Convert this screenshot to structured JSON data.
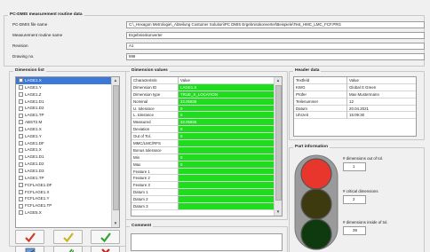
{
  "routine": {
    "title": "PC-DMIS measurement routine data",
    "fields": [
      {
        "label": "PC-DMIS file name",
        "value": "C:\\_Hexagon Metrologie\\_Abteilung Costumer Solution\\PC DMIS Ergebnisskonverter\\Beispiele\\Test_HMC_LMC_FCF.PRG"
      },
      {
        "label": "Measurement routine name",
        "value": "Ergebnisskonverter"
      },
      {
        "label": "Revision",
        "value": "A1"
      },
      {
        "label": "Drawing no.",
        "value": "999"
      }
    ]
  },
  "dimension_list": {
    "title": "Dimension list",
    "items": [
      "LAGE1.X",
      "LAGE1.Y",
      "LAGE1.Z",
      "LAGE1.D1",
      "LAGE1.D2",
      "LAGE1.TP",
      "ABST2.M",
      "LAGE1.X",
      "LAGE1.Y",
      "LAGE1.DF",
      "LAGE1.X",
      "LAGE1.D1",
      "LAGE1.D2",
      "LAGE1.D3",
      "LAGE1.TP",
      "FCFLAGE1.DF",
      "FCFLAGE1.X",
      "FCFLAGE1.Y",
      "FCFLAGE1.TP",
      "LAGE5.X"
    ],
    "selected_index": 0
  },
  "dimension_values": {
    "title": "Dimension values",
    "columns": [
      "Characteristic",
      "Value"
    ],
    "rows": [
      {
        "name": "Dimension ID",
        "value": "LAGE1.X"
      },
      {
        "name": "Dimension type",
        "value": "TRUE_X_LOCATION"
      },
      {
        "name": "Nominal",
        "value": "32.05838"
      },
      {
        "name": "U. tolerance",
        "value": "0"
      },
      {
        "name": "L. tolerance",
        "value": "0"
      },
      {
        "name": "Measured",
        "value": "32.05838"
      },
      {
        "name": "Deviation",
        "value": "0"
      },
      {
        "name": "Out of Tol.",
        "value": "0"
      },
      {
        "name": "MMC/LMC/RFS",
        "value": ""
      },
      {
        "name": "Bonus tolerance",
        "value": ""
      },
      {
        "name": "Min",
        "value": "0"
      },
      {
        "name": "Max",
        "value": "0"
      },
      {
        "name": "Feature 1",
        "value": ""
      },
      {
        "name": "Feature 2",
        "value": ""
      },
      {
        "name": "Feature 3",
        "value": ""
      },
      {
        "name": "Datum 1",
        "value": ""
      },
      {
        "name": "Datum 2",
        "value": ""
      },
      {
        "name": "Datum 3",
        "value": ""
      }
    ]
  },
  "header_data": {
    "title": "Header data",
    "columns": [
      "Textfeld",
      "Value"
    ],
    "rows": [
      {
        "name": "KWG",
        "value": "Global S Green"
      },
      {
        "name": "Prüfer",
        "value": "Max Mustermann"
      },
      {
        "name": "Teilenummer",
        "value": "12"
      },
      {
        "name": "Datum",
        "value": "20.04.2021"
      },
      {
        "name": "Uhrzeit",
        "value": "15:09:30"
      }
    ]
  },
  "part_information": {
    "title": "Part information",
    "out_of_tol_label": "# dimensions out of tol.",
    "out_of_tol_value": "1",
    "critical_label": "# critical dimensions",
    "critical_value": "2",
    "inside_label": "# dimensions inside of tol.",
    "inside_value": "39"
  },
  "comment": {
    "title": "Comment"
  },
  "colors": {
    "green_cell": "#1fdc1f",
    "selection": "#3b78d8",
    "light_red": "#e8362d",
    "light_yellow_off": "#3d3a10",
    "light_green_off": "#0f3a0f",
    "traffic_body": "#9a9a9a"
  }
}
